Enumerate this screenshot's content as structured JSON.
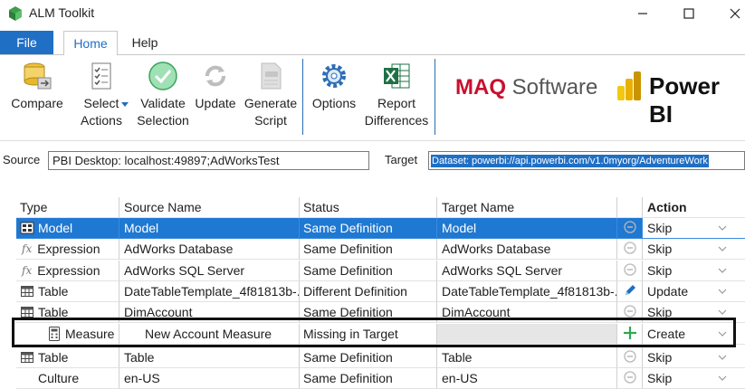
{
  "window": {
    "title": "ALM Toolkit"
  },
  "ribbon": {
    "tabs": {
      "file": "File",
      "home": "Home",
      "help": "Help"
    },
    "buttons": {
      "compare": "Compare",
      "select_actions": "Select\nActions",
      "validate_selection": "Validate\nSelection",
      "update": "Update",
      "generate_script": "Generate\nScript",
      "options": "Options",
      "report_differences": "Report\nDifferences"
    },
    "brand": {
      "maq_bold": "MAQ",
      "maq_rest": " Software",
      "powerbi": "Power BI"
    }
  },
  "connection": {
    "source_label": "Source",
    "source_value": "PBI Desktop: localhost:49897;AdWorksTest",
    "target_label": "Target",
    "target_value": "Dataset: powerbi://api.powerbi.com/v1.0myorg/AdventureWork"
  },
  "grid": {
    "headers": {
      "type": "Type",
      "source_name": "Source Name",
      "status": "Status",
      "target_name": "Target Name",
      "action": "Action"
    },
    "rows": [
      {
        "type": "Model",
        "type_icon": "model-icon",
        "source": "Model",
        "status": "Same Definition",
        "target": "Model",
        "status_icon": "skip-circle-icon",
        "action": "Skip"
      },
      {
        "type": "Expression",
        "type_icon": "fx-icon",
        "source": "AdWorks Database",
        "status": "Same Definition",
        "target": "AdWorks Database",
        "status_icon": "skip-circle-icon",
        "action": "Skip"
      },
      {
        "type": "Expression",
        "type_icon": "fx-icon",
        "source": "AdWorks SQL Server",
        "status": "Same Definition",
        "target": "AdWorks SQL Server",
        "status_icon": "skip-circle-icon",
        "action": "Skip"
      },
      {
        "type": "Table",
        "type_icon": "table-icon",
        "source": "DateTableTemplate_4f81813b-...",
        "status": "Different Definition",
        "target": "DateTableTemplate_4f81813b-...",
        "status_icon": "pencil-icon",
        "action": "Update"
      },
      {
        "type": "Table",
        "type_icon": "table-icon",
        "source": "DimAccount",
        "status": "Same Definition",
        "target": "DimAccount",
        "status_icon": "skip-circle-icon",
        "action": "Skip"
      },
      {
        "type": "Measure",
        "type_icon": "calculator-icon",
        "source": "New Account Measure",
        "status": "Missing in Target",
        "target": "",
        "status_icon": "plus-icon",
        "action": "Create"
      },
      {
        "type": "Table",
        "type_icon": "table-icon",
        "source": "Table",
        "status": "Same Definition",
        "target": "Table",
        "status_icon": "skip-circle-icon",
        "action": "Skip"
      },
      {
        "type": "Culture",
        "type_icon": "",
        "source": "en-US",
        "status": "Same Definition",
        "target": "en-US",
        "status_icon": "skip-circle-icon",
        "action": "Skip"
      }
    ]
  },
  "colors": {
    "accent": "#1f6fc5",
    "selected_row": "#1f78d1",
    "maq_red": "#c8102e",
    "create_green": "#2fa84f"
  }
}
